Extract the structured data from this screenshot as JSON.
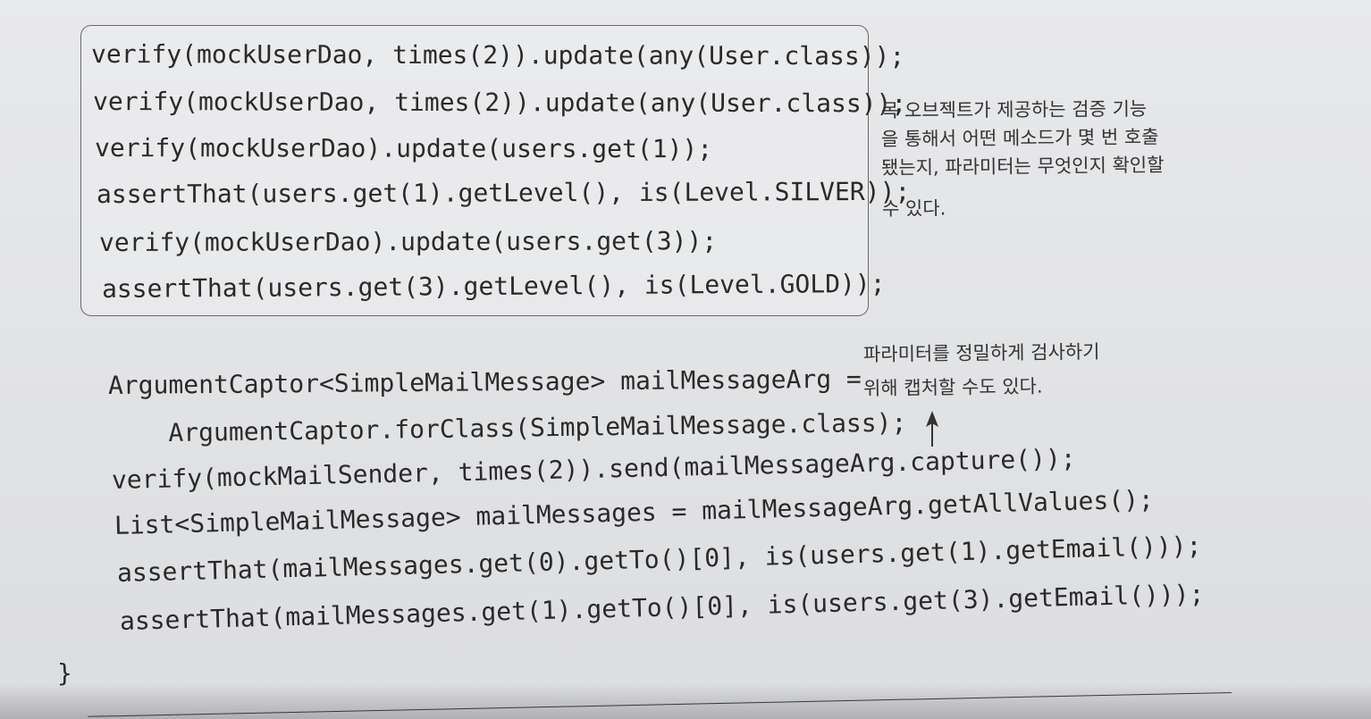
{
  "code_box_lines": [
    "verify(mockUserDao, times(2)).update(any(User.class));",
    "verify(mockUserDao, times(2)).update(any(User.class));",
    "verify(mockUserDao).update(users.get(1));",
    "assertThat(users.get(1).getLevel(), is(Level.SILVER));",
    "verify(mockUserDao).update(users.get(3));",
    "assertThat(users.get(3).getLevel(), is(Level.GOLD));"
  ],
  "note_mock_verify": [
    "목 오브젝트가 제공하는 검증 기능",
    "을 통해서 어떤 메소드가 몇 번 호출",
    "됐는지, 파라미터는 무엇인지 확인할",
    "수 있다."
  ],
  "code_lines": [
    "ArgumentCaptor<SimpleMailMessage> mailMessageArg =",
    "    ArgumentCaptor.forClass(SimpleMailMessage.class);",
    "verify(mockMailSender, times(2)).send(mailMessageArg.capture());",
    "List<SimpleMailMessage> mailMessages = mailMessageArg.getAllValues();",
    "assertThat(mailMessages.get(0).getTo()[0], is(users.get(1).getEmail()));",
    "assertThat(mailMessages.get(1).getTo()[0], is(users.get(3).getEmail()));"
  ],
  "note_captor": [
    "파라미터를 정밀하게 검사하기",
    "위해 캡처할 수도 있다."
  ],
  "closing_brace": "}"
}
